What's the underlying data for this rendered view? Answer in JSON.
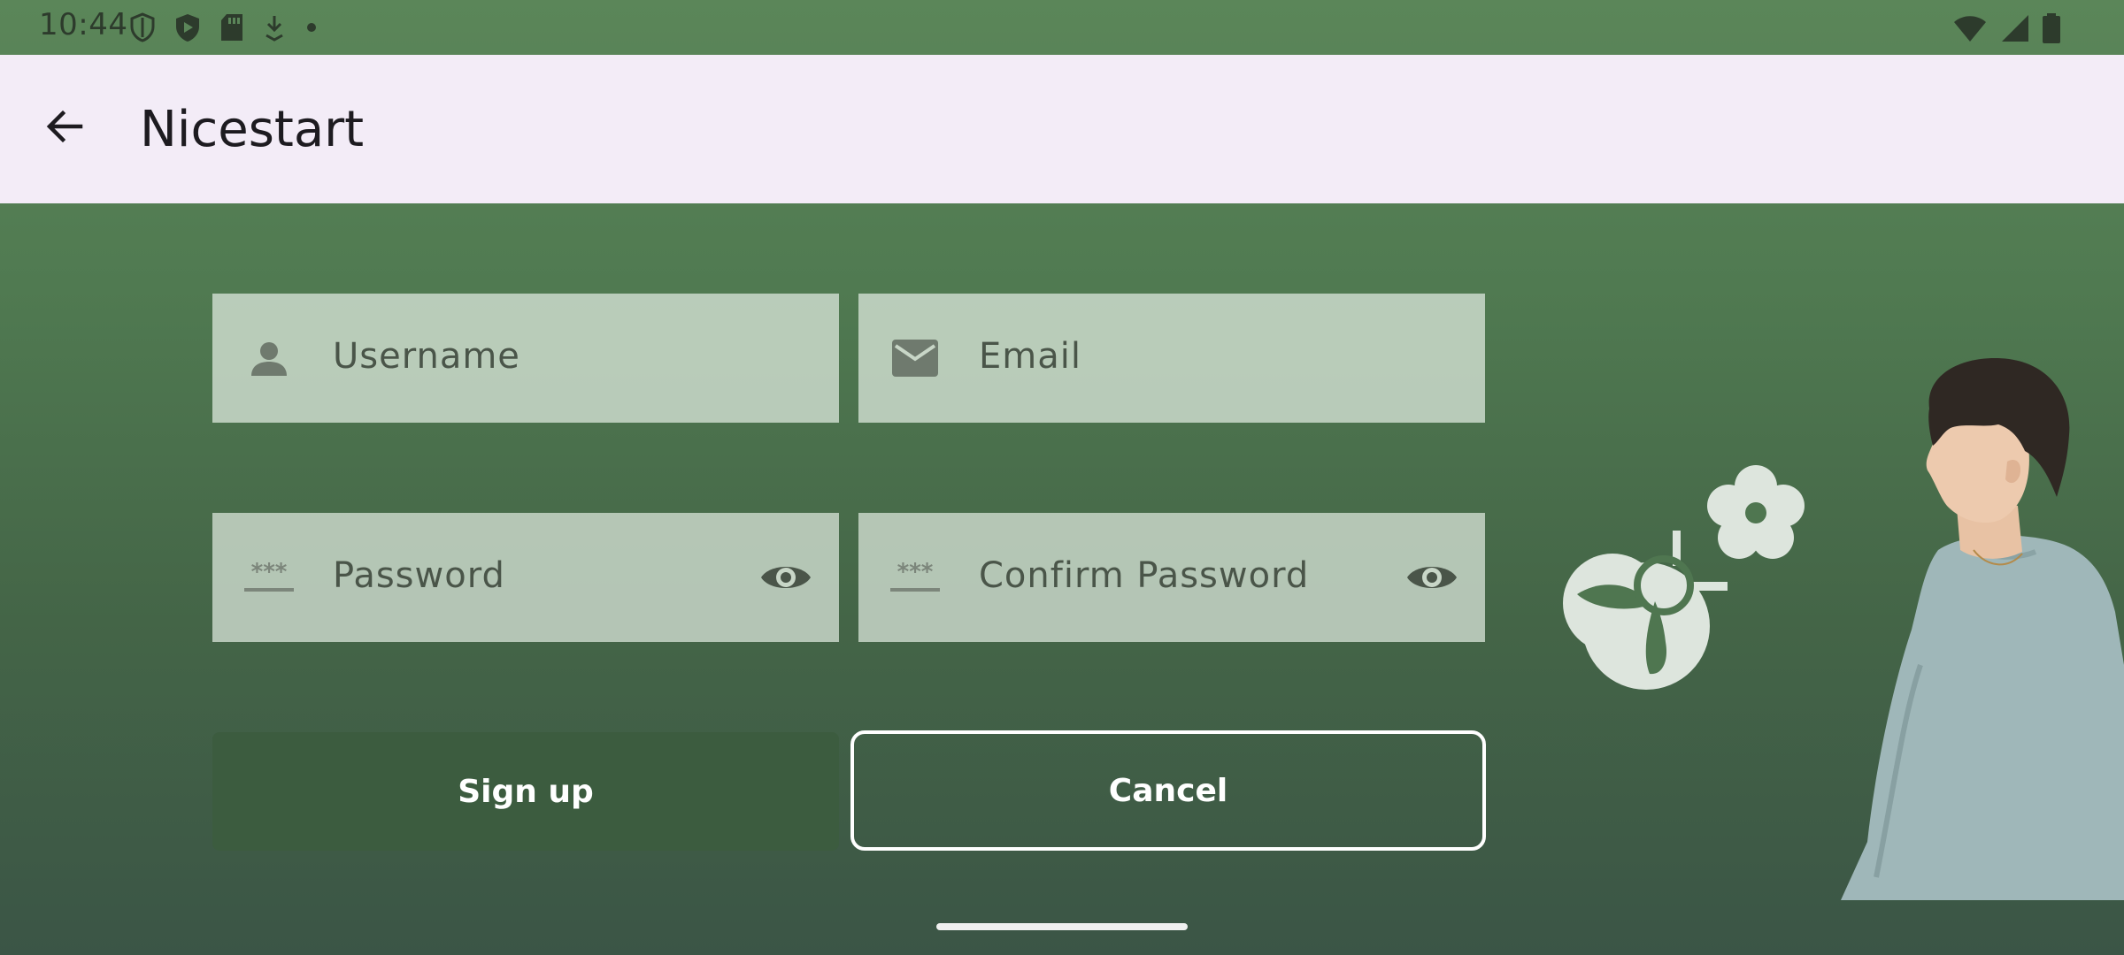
{
  "status_bar": {
    "time": "10:44",
    "left_icons": [
      "shield-icon",
      "play-protect-icon",
      "sd-card-icon",
      "download-icon",
      "dot-icon"
    ],
    "right_icons": [
      "wifi-icon",
      "signal-icon",
      "battery-icon"
    ]
  },
  "app_bar": {
    "title": "Nicestart",
    "back_icon": "arrow-back-icon",
    "background": "#f3ecf7"
  },
  "form": {
    "username": {
      "placeholder": "Username",
      "icon": "person-icon"
    },
    "email": {
      "placeholder": "Email",
      "icon": "mail-icon"
    },
    "password": {
      "placeholder": "Password",
      "icon": "password-icon",
      "toggle_icon": "eye-icon"
    },
    "confirm_password": {
      "placeholder": "Confirm Password",
      "icon": "password-icon",
      "toggle_icon": "eye-icon"
    }
  },
  "buttons": {
    "signup_label": "Sign up",
    "cancel_label": "Cancel"
  },
  "colors": {
    "background_top": "#5b8659",
    "background_bottom": "#3b5546",
    "signup_button": "#3c5c3f",
    "field_fill": "#d7e4d7"
  }
}
